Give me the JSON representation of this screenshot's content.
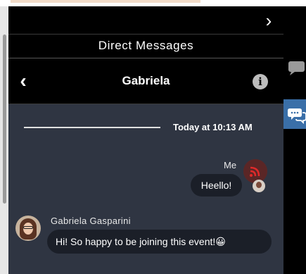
{
  "header": {
    "expand_glyph": "›",
    "panel_title": "Direct Messages",
    "back_glyph": "‹",
    "contact_name": "Gabriela",
    "info_glyph": "i"
  },
  "conversation": {
    "date_label": "Today at 10:13 AM",
    "messages": [
      {
        "sender": "Me",
        "text": "Heello!",
        "outgoing": true
      },
      {
        "sender": "Gabriela Gasparini",
        "text": "Hi! So happy to be joining this event!😀",
        "outgoing": false
      }
    ]
  },
  "colors": {
    "panel_bg": "#2f3542",
    "bubble_bg": "#1b1f28",
    "header_bg": "#000000",
    "active_rail": "#3a6fa8"
  },
  "icons": {
    "expand": "chevron-right-icon",
    "back": "chevron-left-icon",
    "info": "info-icon",
    "rail_chat": "chat-bubble-icon",
    "rail_messages": "direct-messages-icon"
  }
}
